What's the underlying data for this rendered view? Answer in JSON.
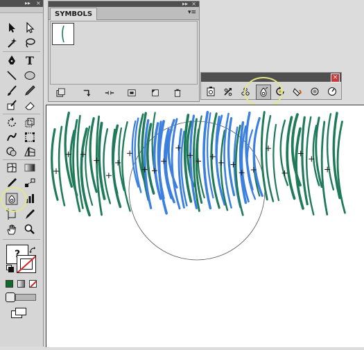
{
  "tools_panel": {
    "collapse_glyph": "▸▸",
    "close_glyph": "×",
    "fill_stroke_question": "?",
    "icons": [
      "selection-icon",
      "direct-selection-icon",
      "magic-wand-icon",
      "lasso-icon",
      "pen-icon",
      "type-icon",
      "line-icon",
      "ellipse-icon",
      "paintbrush-icon",
      "pencil-icon",
      "blob-brush-icon",
      "eraser-icon",
      "rotate-icon",
      "scale-icon",
      "warp-icon",
      "free-transform-icon",
      "shape-builder-icon",
      "perspective-grid-icon",
      "mesh-icon",
      "gradient-icon",
      "eyedropper-icon",
      "blend-icon",
      "symbol-sprayer-icon",
      "column-graph-icon",
      "artboard-icon",
      "slice-icon",
      "hand-icon",
      "zoom-icon"
    ]
  },
  "symbols_panel": {
    "title": "SYMBOLS",
    "collapse_glyph": "▸▸",
    "close_glyph": "×",
    "menu_glyph": "▾≡",
    "footer_icons": [
      "symbol-libraries-icon",
      "place-symbol-icon",
      "break-link-icon",
      "symbol-options-icon",
      "new-symbol-icon",
      "delete-symbol-icon"
    ]
  },
  "symbolism_toolbar": {
    "close_glyph": "×",
    "tools": [
      "symbol-sprayer-icon",
      "symbol-shifter-icon",
      "symbol-scruncher-icon",
      "symbol-sizer-icon",
      "symbol-spinner-icon",
      "symbol-stainer-icon",
      "symbol-screener-icon",
      "symbol-styler-icon"
    ],
    "selected": "symbol-sizer-icon"
  },
  "colors": {
    "panel_bg": "#d6d6d6",
    "header_bg": "#4f4f4f",
    "highlight_ring": "#e5e58a",
    "grass_dark": "#1f7a5a",
    "grass_light": "#3b7fe0"
  }
}
